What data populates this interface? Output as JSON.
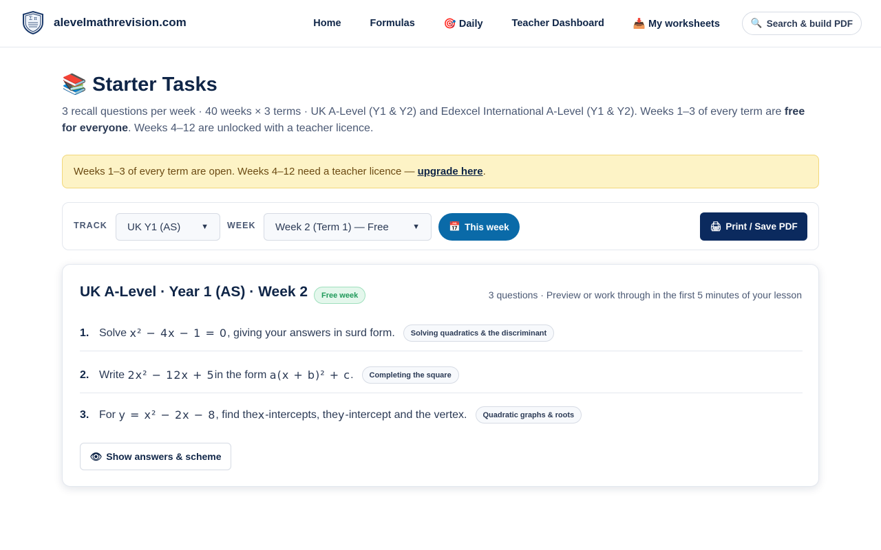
{
  "header": {
    "site_name": "alevelmathrevision.com",
    "nav": [
      {
        "label": "Home"
      },
      {
        "label": "Formulas"
      },
      {
        "label": "🎯 Daily"
      },
      {
        "label": "Teacher Dashboard"
      },
      {
        "label": "📥 My worksheets"
      }
    ],
    "search_label": "Search & build PDF",
    "search_icon": "🔍"
  },
  "main": {
    "title": "Starter Tasks",
    "title_icon": "📚",
    "intro_part1": "3 recall questions per week · 40 weeks × 3 terms · UK A-Level (Y1 & Y2) and Edexcel International A-Level (Y1 & Y2). Weeks 1–3 of every term are ",
    "intro_bold": "free for everyone",
    "intro_part2": ". Weeks 4–12 are unlocked with a teacher licence.",
    "notice_text": "Weeks 1–3 of every term are open. Weeks 4–12 need a teacher licence —",
    "notice_link": "upgrade here",
    "notice_end": "."
  },
  "controls": {
    "track_label": "TRACK",
    "track_value": "UK Y1 (AS)",
    "week_label": "WEEK",
    "week_value": "Week 2 (Term 1) — Free",
    "this_week_icon": "📅",
    "this_week_label": "This week",
    "print_icon": "🖨",
    "print_label": "Print / Save PDF"
  },
  "card": {
    "title": "UK A-Level · Year 1 (AS) · Week 2",
    "badge": "Free week",
    "meta": "3 questions · Preview or work through in the first 5 minutes of your lesson",
    "questions": [
      {
        "num": "1.",
        "pre": "Solve ",
        "math": "x² − 4x − 1 = 0",
        "post": ", giving your answers in surd form.",
        "tag": "Solving quadratics & the discriminant"
      },
      {
        "num": "2.",
        "pre": "Write ",
        "math": "2x² − 12x + 5",
        "mid": " in the form ",
        "math2": "a(x + b)² + c",
        "post": ".",
        "tag": "Completing the square"
      },
      {
        "num": "3.",
        "pre": "For ",
        "math": "y = x² − 2x − 8",
        "mid": ", find the ",
        "math2": "x",
        "mid2": "-intercepts, the ",
        "math3": "y",
        "post": "-intercept and the vertex.",
        "tag": "Quadratic graphs & roots"
      }
    ],
    "answers_icon": "👁",
    "answers_label": "Show answers & scheme"
  }
}
